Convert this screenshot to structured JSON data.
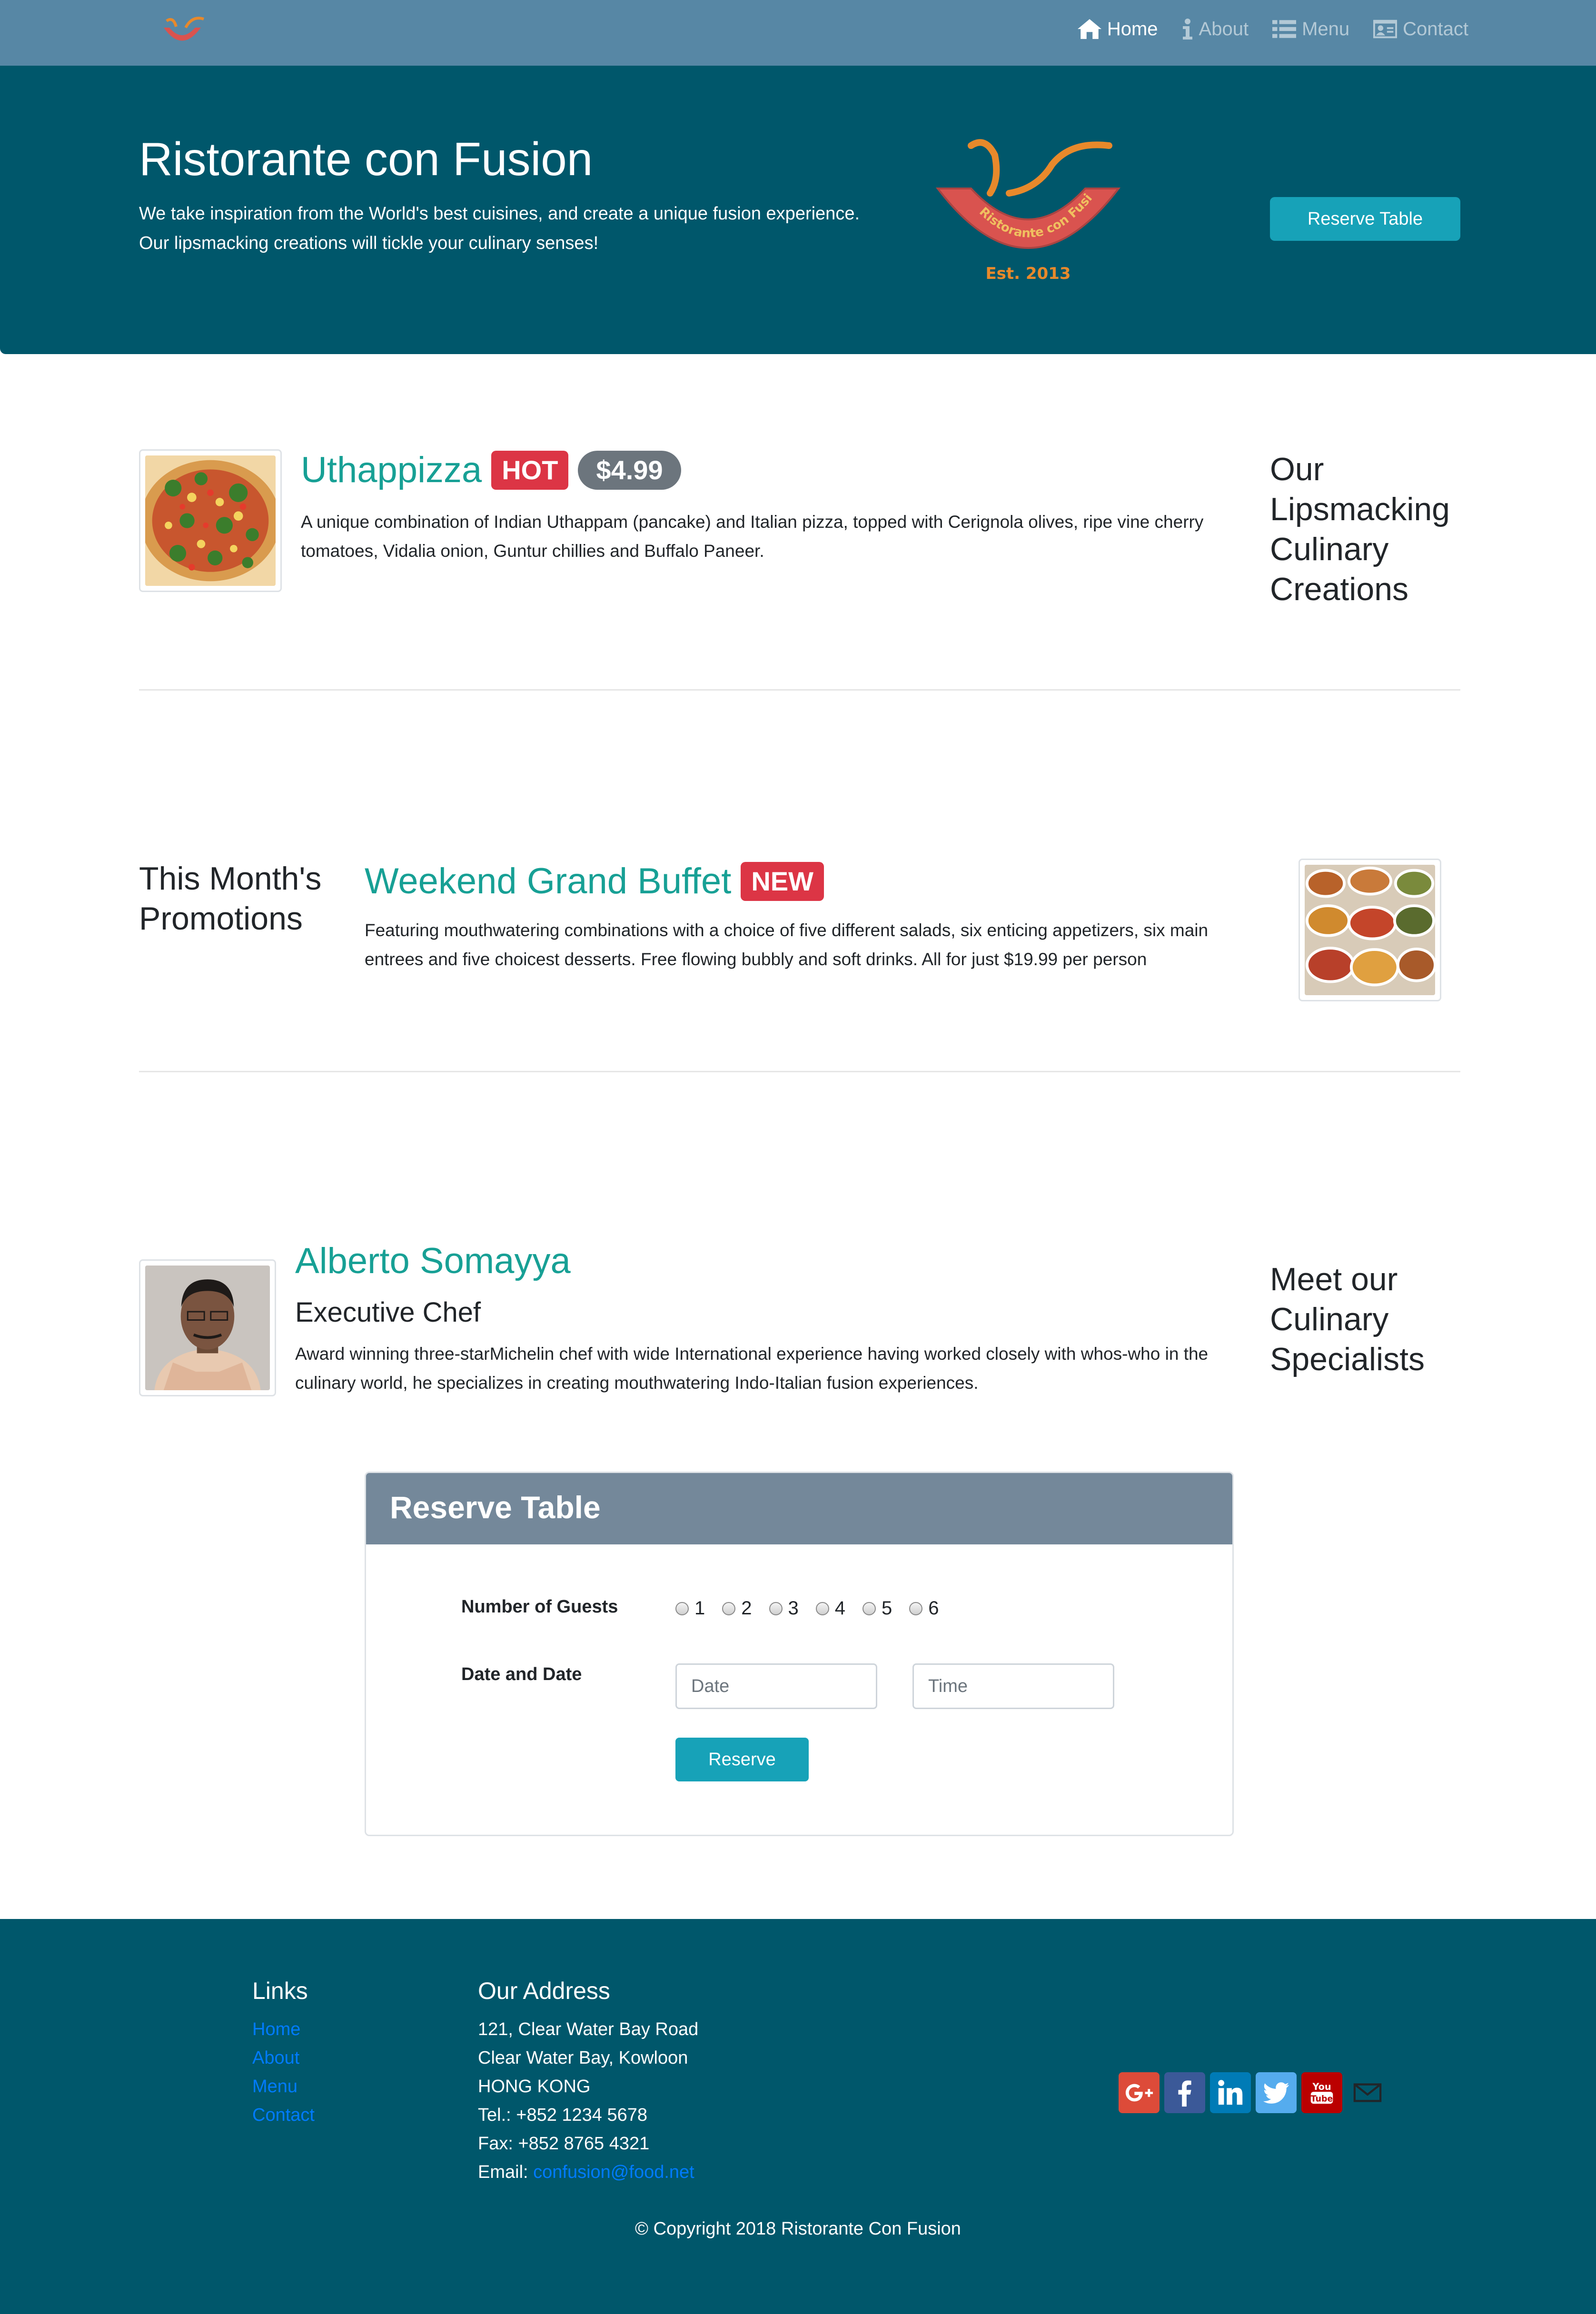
{
  "navbar": {
    "items": [
      {
        "label": "Home",
        "icon": "home-icon",
        "active": true
      },
      {
        "label": "About",
        "icon": "info-icon",
        "active": false
      },
      {
        "label": "Menu",
        "icon": "list-icon",
        "active": false
      },
      {
        "label": "Contact",
        "icon": "address-card-icon",
        "active": false
      }
    ]
  },
  "jumbotron": {
    "title": "Ristorante con Fusion",
    "line1": "We take inspiration from the World's best cuisines, and create a unique fusion experience.",
    "line2": "Our lipsmacking creations will tickle your culinary senses!",
    "logo_text": "Ristorante con Fusion",
    "logo_est": "Est. 2013",
    "button_label": "Reserve Table"
  },
  "dish": {
    "name": "Uthappizza",
    "badge": "HOT",
    "price": "$4.99",
    "description": "A unique combination of Indian Uthappam (pancake) and Italian pizza, topped with Cerignola olives, ripe vine cherry tomatoes, Vidalia onion, Guntur chillies and Buffalo Paneer.",
    "section_heading": "Our Lipsmacking Culinary Creations"
  },
  "promotion": {
    "section_heading": "This Month's Promotions",
    "name": "Weekend Grand Buffet",
    "badge": "NEW",
    "description": "Featuring mouthwatering combinations with a choice of five different salads, six enticing appetizers, six main entrees and five choicest desserts. Free flowing bubbly and soft drinks. All for just $19.99 per person"
  },
  "leader": {
    "name": "Alberto Somayya",
    "designation": "Executive Chef",
    "description": "Award winning three-starMichelin chef with wide International experience having worked closely with whos-who in the culinary world, he specializes in creating mouthwatering Indo-Italian fusion experiences.",
    "section_heading": "Meet our Culinary Specialists"
  },
  "reserve": {
    "title": "Reserve Table",
    "guests_label": "Number of Guests",
    "guest_options": [
      "1",
      "2",
      "3",
      "4",
      "5",
      "6"
    ],
    "date_label": "Date and Date",
    "date_placeholder": "Date",
    "time_placeholder": "Time",
    "submit_label": "Reserve"
  },
  "footer": {
    "links_heading": "Links",
    "links": [
      "Home",
      "About",
      "Menu",
      "Contact"
    ],
    "address_heading": "Our Address",
    "address_lines": [
      "121, Clear Water Bay Road",
      "Clear Water Bay, Kowloon",
      "HONG KONG",
      "Tel.: +852 1234 5678",
      "Fax: +852 8765 4321"
    ],
    "email_label": "Email: ",
    "email": "confusion@food.net",
    "social": [
      {
        "icon": "google-plus-icon",
        "color": "#dd4b39"
      },
      {
        "icon": "facebook-icon",
        "color": "#3b5998"
      },
      {
        "icon": "linkedin-icon",
        "color": "#007bb6"
      },
      {
        "icon": "twitter-icon",
        "color": "#55acee"
      },
      {
        "icon": "youtube-icon",
        "color": "#bb0000"
      },
      {
        "icon": "envelope-icon",
        "color": "transparent"
      }
    ],
    "copyright": "© Copyright 2018 Ristorante Con Fusion"
  }
}
